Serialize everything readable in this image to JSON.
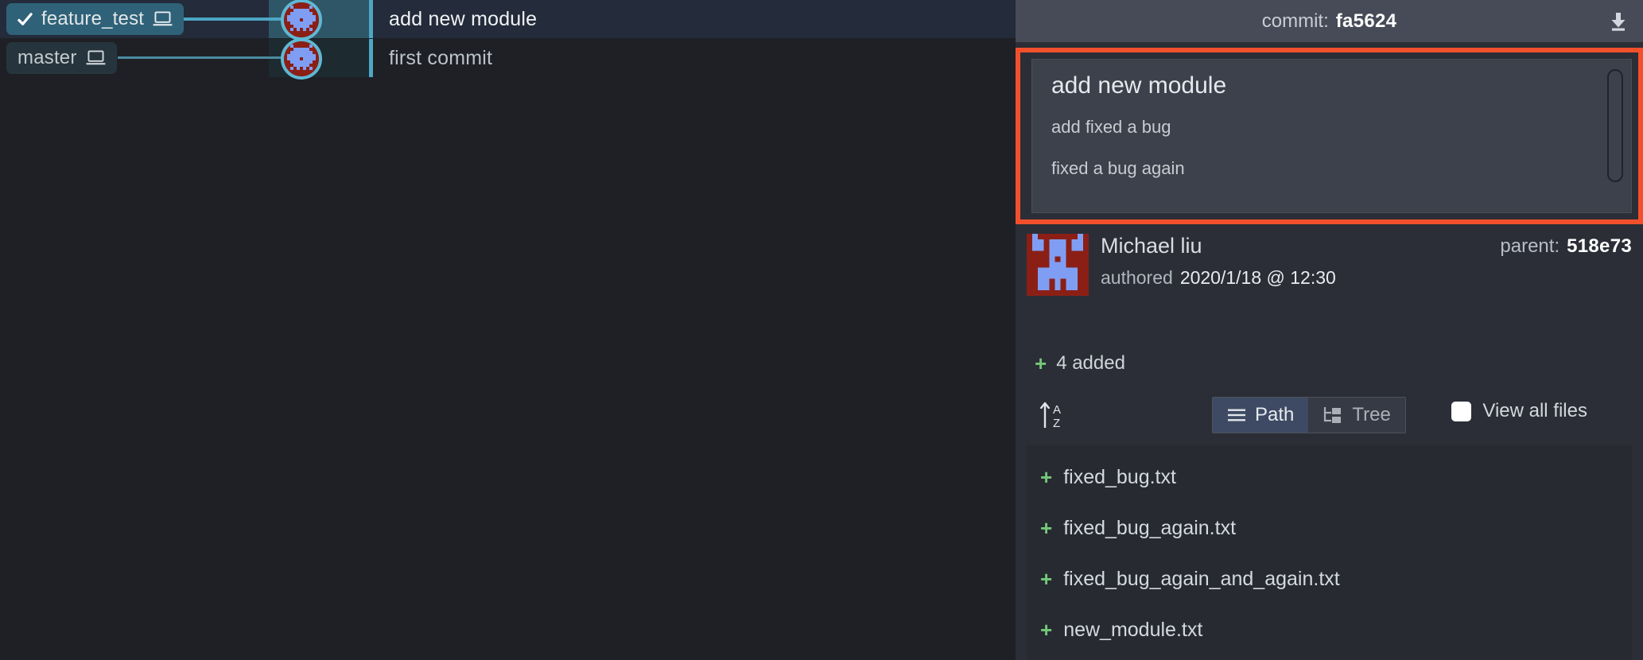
{
  "colors": {
    "app_bg": "#1e2026",
    "panel_bg": "#2b2e36",
    "header_bg": "#474b57",
    "accent_teal": "#4da6c4",
    "node_ring": "#5fb8d4",
    "identicon_red": "#8b1f16",
    "identicon_blue": "#7f9ef3",
    "highlight_red": "#f2502c",
    "added_green": "#73c877",
    "selected_row": "#242b3a",
    "toggle_active": "#3e4a63"
  },
  "graph": {
    "rows": [
      {
        "branch_label": "feature_test",
        "branch_is_current": true,
        "branch_icon": "laptop-icon",
        "check_icon": "check-icon",
        "commit_subject": "add new module",
        "selected": true
      },
      {
        "branch_label": "master",
        "branch_is_current": false,
        "branch_icon": "laptop-icon",
        "commit_subject": "first commit",
        "selected": false
      }
    ]
  },
  "detail": {
    "header": {
      "commit_label": "commit:",
      "commit_hash": "fa5624",
      "download_icon": "download-icon"
    },
    "message": {
      "title": "add new module",
      "body_lines": [
        "add fixed a bug",
        "fixed a bug again"
      ]
    },
    "author": {
      "avatar_icon": "identicon-avatar",
      "name": "Michael liu",
      "authored_label": "authored",
      "authored_date": "2020/1/18 @ 12:30",
      "parent_label": "parent:",
      "parent_hash": "518e73"
    },
    "changes": {
      "added_icon": "plus-icon",
      "added_text": "4 added"
    },
    "toolbar": {
      "sort_icon": "sort-alpha-asc-icon",
      "view_modes": [
        {
          "label": "Path",
          "icon": "list-lines-icon",
          "active": true
        },
        {
          "label": "Tree",
          "icon": "tree-structure-icon",
          "active": false
        }
      ],
      "view_all_label": "View all files",
      "view_all_checked": false
    },
    "files": [
      {
        "status_icon": "plus-icon",
        "name": "fixed_bug.txt"
      },
      {
        "status_icon": "plus-icon",
        "name": "fixed_bug_again.txt"
      },
      {
        "status_icon": "plus-icon",
        "name": "fixed_bug_again_and_again.txt"
      },
      {
        "status_icon": "plus-icon",
        "name": "new_module.txt"
      }
    ]
  }
}
